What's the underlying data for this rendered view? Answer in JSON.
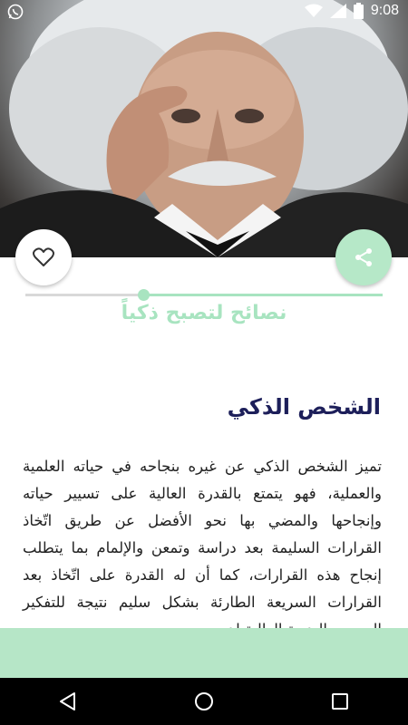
{
  "status_bar": {
    "time": "9:08",
    "icons": [
      "whatsapp-icon",
      "wifi-icon",
      "signal-icon",
      "battery-icon"
    ]
  },
  "hero": {
    "image": "einstein-portrait"
  },
  "actions": {
    "favorite_icon": "heart-outline-icon",
    "share_icon": "share-icon"
  },
  "progress": {
    "value": 0.67
  },
  "subtitle": "نصائح لتصبح ذكياً",
  "article": {
    "heading": "الشخص الذكي",
    "body": "تميز الشخص الذكي عن غيره بنجاحه في حياته العلمية والعملية، فهو يتمتع بالقدرة العالية على تسيير حياته وإنجاحها والمضي بها نحو الأفضل عن طريق اتّخاذ القرارات السليمة بعد دراسة وتمعن والإلمام بما يتطلب إنجاح هذه القرارات، كما أن له القدرة على اتّخاذ بعد القرارات السريعة الطارئة بشكل سليم نتيجة للتفكير السريع والبديهة العالية لديه"
  },
  "colors": {
    "accent": "#a8e4c0",
    "heading": "#1d1f5a",
    "panel": "#b6e6c7"
  },
  "nav": {
    "buttons": [
      "back-icon",
      "home-icon",
      "recents-icon"
    ]
  }
}
